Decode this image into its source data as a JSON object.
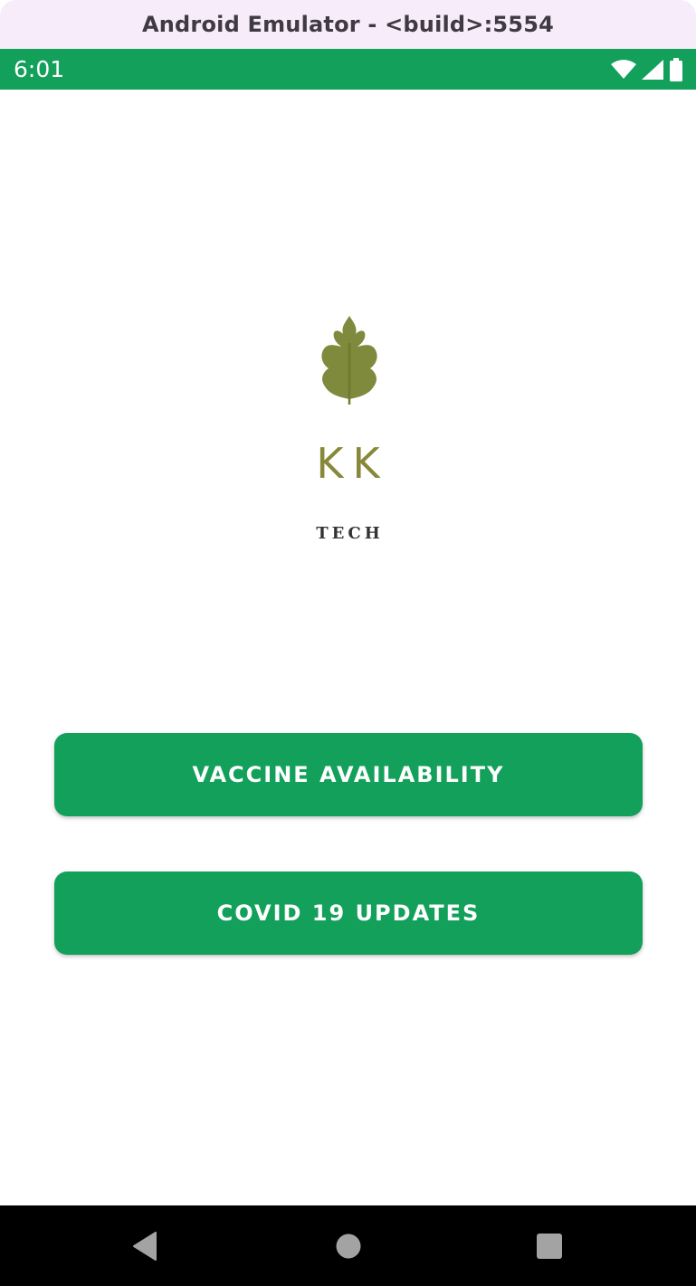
{
  "window": {
    "title": "Android Emulator - <build>:5554"
  },
  "status_bar": {
    "time": "6:01",
    "background": "#12a05a",
    "icons": [
      "wifi-icon",
      "cell-signal-icon",
      "battery-icon"
    ]
  },
  "logo": {
    "icon": "leaf-icon",
    "name": "KK",
    "subtitle": "TECH",
    "color": "#87883a"
  },
  "buttons": {
    "vaccine_label": "VACCINE AVAILABILITY",
    "covid_label": "COVID 19 UPDATES",
    "color": "#12a05a"
  },
  "nav_bar": {
    "icons": [
      "back-icon",
      "home-icon",
      "recents-icon"
    ]
  }
}
